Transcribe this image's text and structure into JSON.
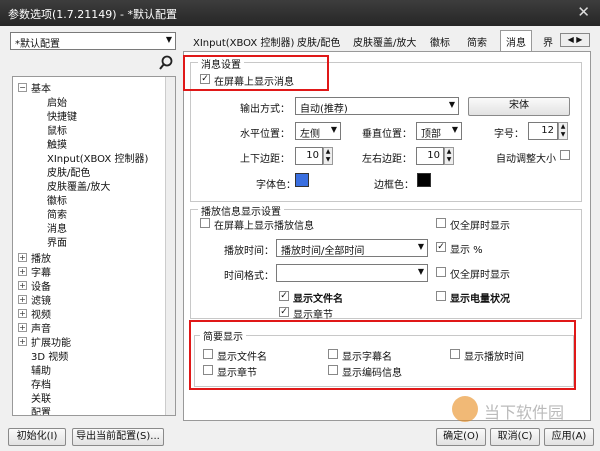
{
  "window": {
    "title": "参数选项(1.7.21149) - *默认配置",
    "close": "✕"
  },
  "profile_select": {
    "value": "*默认配置"
  },
  "search_icon": "search-icon",
  "tabs": [
    "XInput(XBOX 控制器)",
    "皮肤/配色",
    "皮肤覆盖/放大",
    "徽标",
    "简索",
    "消息",
    "界"
  ],
  "tree": {
    "root": "基本",
    "children": [
      "启始",
      "快捷键",
      "鼠标",
      "触摸",
      "XInput(XBOX 控制器)",
      "皮肤/配色",
      "皮肤覆盖/放大",
      "徽标",
      "简索",
      "消息",
      "界面"
    ],
    "top": [
      "播放",
      "字幕",
      "设备",
      "滤镜",
      "视频",
      "声音",
      "扩展功能",
      "3D 视频",
      "辅助",
      "存档",
      "关联",
      "配置"
    ]
  },
  "msg_settings": {
    "title": "消息设置",
    "show_on_screen": "在屏幕上显示消息",
    "output_mode_label": "输出方式：",
    "output_mode_value": "自动(推荐)",
    "font_button": "宋体",
    "h_pos_label": "水平位置：",
    "h_pos_value": "左侧",
    "v_pos_label": "垂直位置：",
    "v_pos_value": "顶部",
    "font_size_label": "字号：",
    "font_size_value": "12",
    "tb_margin_label": "上下边距：",
    "tb_margin_value": "10",
    "lr_margin_label": "左右边距：",
    "lr_margin_value": "10",
    "auto_size_label": "自动调整大小",
    "font_color_label": "字体色：",
    "font_color": "#3a6fe0",
    "border_color_label": "边框色：",
    "border_color": "#000000"
  },
  "playback_info": {
    "title": "播放信息显示设置",
    "show_on_screen": "在屏幕上显示播放信息",
    "fullscreen_only_1": "仅全屏时显示",
    "play_time_label": "播放时间：",
    "play_time_value": "播放时间/全部时间",
    "show_percent": "显示 %",
    "time_format_label": "时间格式：",
    "time_format_value": "",
    "fullscreen_only_2": "仅全屏时显示",
    "show_filename": "显示文件名",
    "show_battery": "显示电量状况",
    "show_chapter": "显示章节"
  },
  "brief": {
    "title": "简要显示",
    "show_filename": "显示文件名",
    "show_subtitle_name": "显示字幕名",
    "show_play_time": "显示播放时间",
    "show_chapter": "显示章节",
    "show_codec_info": "显示编码信息"
  },
  "footer": {
    "reset": "初始化(I)",
    "export": "导出当前配置(S)...",
    "ok": "确定(O)",
    "cancel": "取消(C)",
    "apply": "应用(A)"
  },
  "watermark": "当下软件园",
  "colors": {
    "highlight": "#e01818",
    "accent": "#3a6fe0"
  }
}
